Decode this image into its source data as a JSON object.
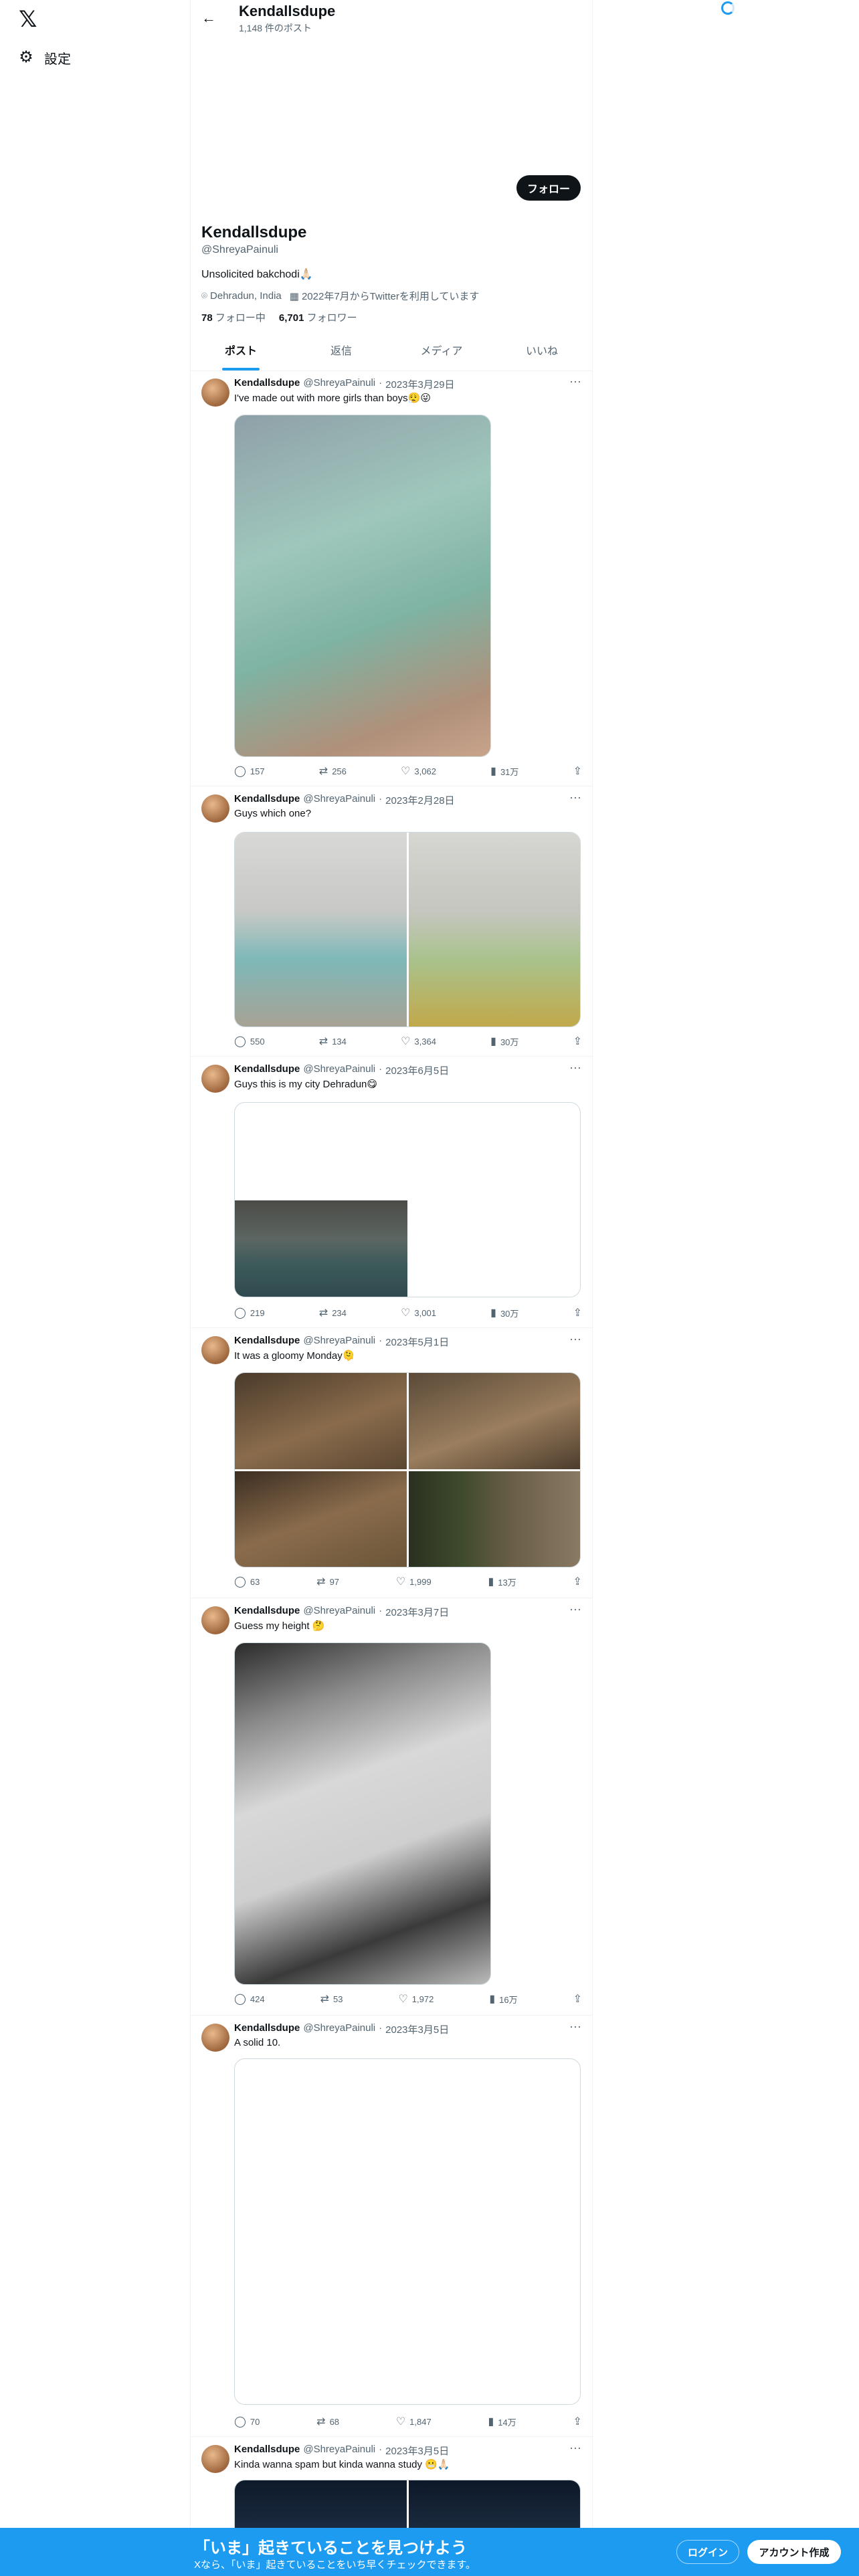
{
  "nav": {
    "logo": "𝕏",
    "settings_label": "設定",
    "settings_icon": "gear-icon"
  },
  "header": {
    "back_icon": "arrow-left-icon",
    "name": "Kendallsdupe",
    "post_count": "1,148 件のポスト"
  },
  "profile": {
    "follow_label": "フォロー",
    "name": "Kendallsdupe",
    "handle": "@ShreyaPainuli",
    "bio": "Unsolicited bakchodi🙏🏻",
    "location": "Dehradun, India",
    "joined": "2022年7月からTwitterを利用しています",
    "following_count": "78",
    "following_label": "フォロー中",
    "followers_count": "6,701",
    "followers_label": "フォロワー"
  },
  "tabs": [
    "ポスト",
    "返信",
    "メディア",
    "いいね"
  ],
  "tweets": [
    {
      "name": "Kendallsdupe",
      "handle": "@ShreyaPainuli",
      "date": "2023年3月29日",
      "text": "I've made out with more girls than boys😮‍💨😜",
      "replies": "157",
      "retweets": "256",
      "likes": "3,062",
      "views": "31万"
    },
    {
      "name": "Kendallsdupe",
      "handle": "@ShreyaPainuli",
      "date": "2023年2月28日",
      "text": "Guys which one?",
      "replies": "550",
      "retweets": "134",
      "likes": "3,364",
      "views": "30万"
    },
    {
      "name": "Kendallsdupe",
      "handle": "@ShreyaPainuli",
      "date": "2023年6月5日",
      "text": "Guys this is my city Dehradun😋",
      "replies": "219",
      "retweets": "234",
      "likes": "3,001",
      "views": "30万"
    },
    {
      "name": "Kendallsdupe",
      "handle": "@ShreyaPainuli",
      "date": "2023年5月1日",
      "text": "It was a gloomy Monday🫠",
      "replies": "63",
      "retweets": "97",
      "likes": "1,999",
      "views": "13万"
    },
    {
      "name": "Kendallsdupe",
      "handle": "@ShreyaPainuli",
      "date": "2023年3月7日",
      "text": "Guess my height 🤔",
      "replies": "424",
      "retweets": "53",
      "likes": "1,972",
      "views": "16万"
    },
    {
      "name": "Kendallsdupe",
      "handle": "@ShreyaPainuli",
      "date": "2023年3月5日",
      "text": "A solid 10.",
      "replies": "70",
      "retweets": "68",
      "likes": "1,847",
      "views": "14万"
    },
    {
      "name": "Kendallsdupe",
      "handle": "@ShreyaPainuli",
      "date": "2023年3月5日",
      "text": "Kinda wanna spam but kinda wanna study 😬🙏🏻"
    }
  ],
  "bottom_bar": {
    "title": "「いま」起きていることを見つけよう",
    "subtitle": "Xなら、「いま」起きていることをいち早くチェックできます。",
    "login_label": "ログイン",
    "signup_label": "アカウント作成"
  },
  "colors": {
    "accent": "#1d9bf0",
    "text": "#0f1419",
    "secondary": "#536471"
  }
}
